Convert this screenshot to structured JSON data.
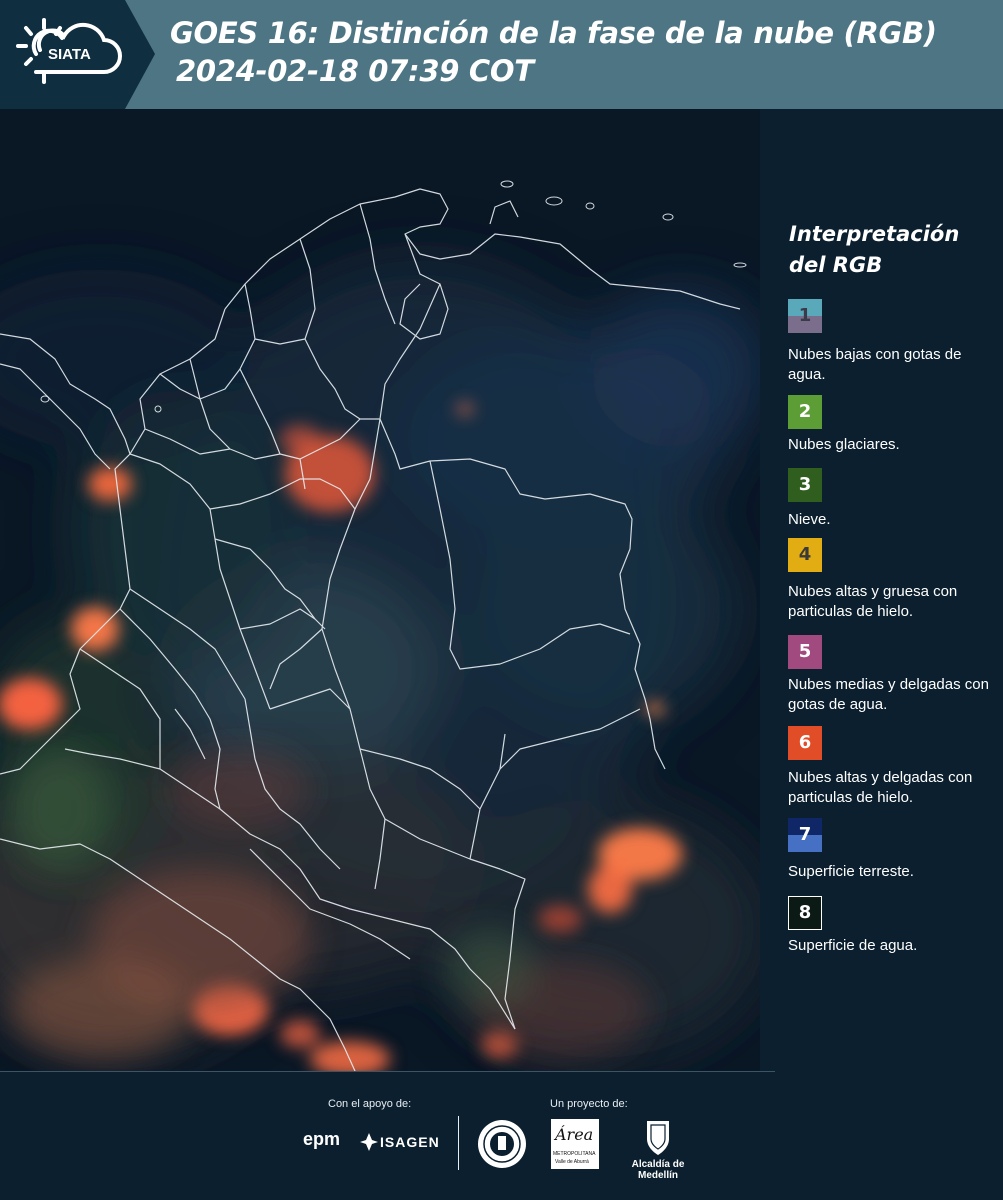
{
  "header": {
    "brand": "SIATA",
    "title_line1": "GOES 16: Distinción de la fase de la nube (RGB)",
    "title_line2": "2024-02-18 07:39 COT"
  },
  "legend": {
    "title_line1": "Interpretación",
    "title_line2": "del RGB",
    "items": [
      {
        "number": "1",
        "label": "Nubes bajas con gotas de agua.",
        "color_top": "#5aa9ba",
        "color_bottom": "#7a6e8c"
      },
      {
        "number": "2",
        "label": "Nubes glaciares.",
        "color": "#5c9e35"
      },
      {
        "number": "3",
        "label": "Nieve.",
        "color": "#2f5e1e"
      },
      {
        "number": "4",
        "label": "Nubes altas y gruesa con particulas de hielo.",
        "color": "#e2ad12"
      },
      {
        "number": "5",
        "label": "Nubes medias y delgadas con gotas de agua.",
        "color": "#a14a80"
      },
      {
        "number": "6",
        "label": "Nubes altas y delgadas con particulas de hielo.",
        "color": "#e04d26"
      },
      {
        "number": "7",
        "label": "Superficie terreste.",
        "color_top": "#0f2766",
        "color_bottom": "#4570c4"
      },
      {
        "number": "8",
        "label": "Superficie de agua.",
        "color": "#0b1a14"
      }
    ]
  },
  "footer": {
    "support_label": "Con el apoyo de:",
    "project_label": "Un proyecto de:",
    "epm": "epm",
    "isagen": "ISAGEN",
    "area_main": "Área",
    "area_sub1": "METROPOLITANA",
    "area_sub2": "Valle de Aburrá",
    "alcaldia": "Alcaldía de Medellín"
  }
}
